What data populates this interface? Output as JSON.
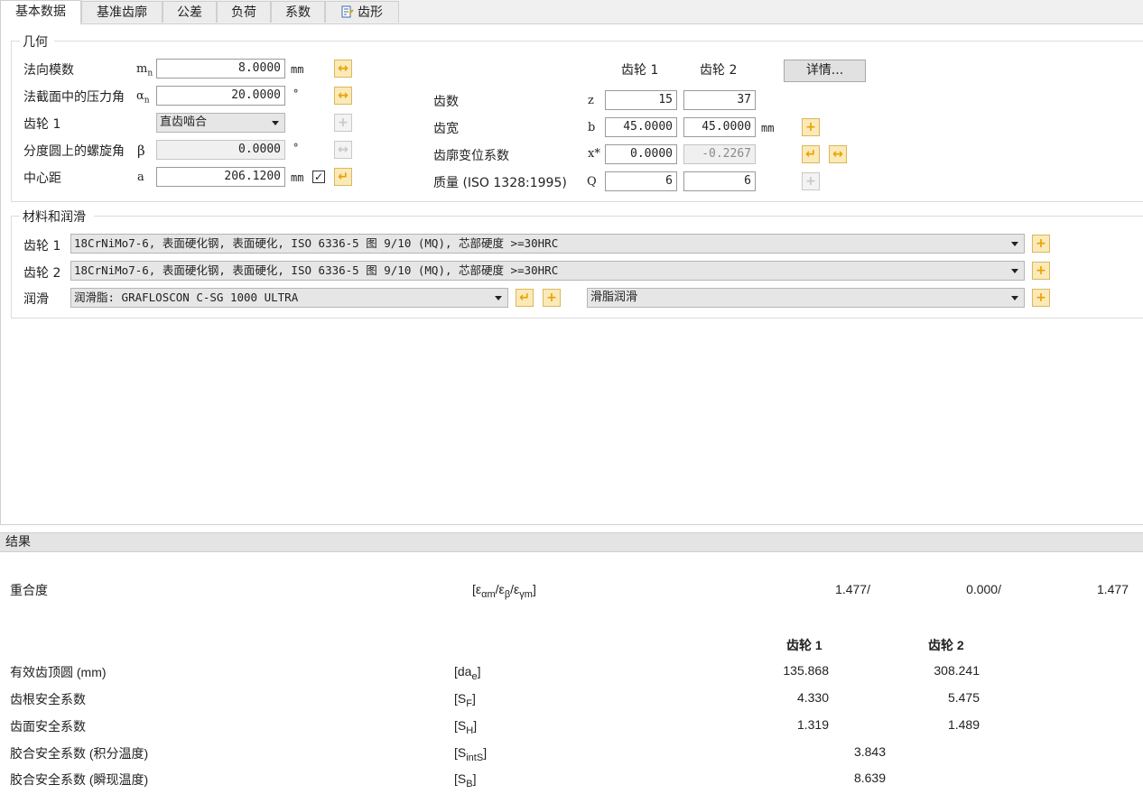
{
  "tabs": [
    "基本数据",
    "基准齿廓",
    "公差",
    "负荷",
    "系数",
    "齿形"
  ],
  "geometry": {
    "title": "几何",
    "rows": [
      {
        "label": "法向模数",
        "symbol_base": "m",
        "symbol_sub": "n",
        "value": "8.0000",
        "unit": "mm"
      },
      {
        "label": "法截面中的压力角",
        "symbol_base": "α",
        "symbol_sub": "n",
        "value": "20.0000",
        "unit": "°"
      },
      {
        "label": "齿轮 1",
        "combo": "直齿啮合"
      },
      {
        "label": "分度圆上的螺旋角",
        "symbol_base": "β",
        "value": "0.0000",
        "unit": "°"
      },
      {
        "label": "中心距",
        "symbol_base": "a",
        "value": "206.1200",
        "unit": "mm",
        "checked": "✓"
      }
    ],
    "gear1_header": "齿轮 1",
    "gear2_header": "齿轮 2",
    "details_button": "详情...",
    "gear_rows": [
      {
        "label": "齿数",
        "symbol": "z",
        "g1": "15",
        "g2": "37",
        "unit": ""
      },
      {
        "label": "齿宽",
        "symbol": "b",
        "g1": "45.0000",
        "g2": "45.0000",
        "unit": "mm"
      },
      {
        "label": "齿廓变位系数",
        "symbol": "x*",
        "g1": "0.0000",
        "g2": "-0.2267",
        "unit": ""
      },
      {
        "label": "质量 (ISO 1328:1995)",
        "symbol": "Q",
        "g1": "6",
        "g2": "6",
        "unit": ""
      }
    ]
  },
  "material": {
    "title": "材料和润滑",
    "gear1_label": "齿轮 1",
    "gear1_value": "18CrNiMo7-6, 表面硬化钢, 表面硬化, ISO 6336-5 图 9/10 (MQ), 芯部硬度 >=30HRC",
    "gear2_label": "齿轮 2",
    "gear2_value": "18CrNiMo7-6, 表面硬化钢, 表面硬化, ISO 6336-5 图 9/10 (MQ), 芯部硬度 >=30HRC",
    "lube_label": "润滑",
    "lube_value": "润滑脂: GRAFLOSCON C-SG 1000 ULTRA",
    "lube_type": "滑脂润滑"
  },
  "results": {
    "title": "结果",
    "contact_label": "重合度",
    "contact_symbol": "[εαm/εβ/εγm]",
    "contact_values": [
      "1.477/",
      "0.000/",
      "1.477"
    ],
    "gear1_header": "齿轮 1",
    "gear2_header": "齿轮 2",
    "rows": [
      {
        "label": "有效齿顶圆 (mm)",
        "sym_base": "[da",
        "sym_sub": "e",
        "g1": "135.868",
        "g2": "308.241"
      },
      {
        "label": "齿根安全系数",
        "sym_base": "[S",
        "sym_sub": "F",
        "g1": "4.330",
        "g2": "5.475"
      },
      {
        "label": "齿面安全系数",
        "sym_base": "[S",
        "sym_sub": "H",
        "g1": "1.319",
        "g2": "1.489"
      },
      {
        "label": "胶合安全系数 (积分温度)",
        "sym_base": "[S",
        "sym_sub": "intS",
        "single": "3.843"
      },
      {
        "label": "胶合安全系数 (瞬现温度)",
        "sym_base": "[S",
        "sym_sub": "B",
        "single": "8.639"
      }
    ]
  },
  "icons": {
    "arrow_both": "↔",
    "arrow_enter": "↵",
    "plus": "+",
    "tooth_tab_icon": "profile-icon"
  },
  "colors": {
    "accent_orange": "#e8a200",
    "button_active_bg": "#fbe9b8"
  }
}
